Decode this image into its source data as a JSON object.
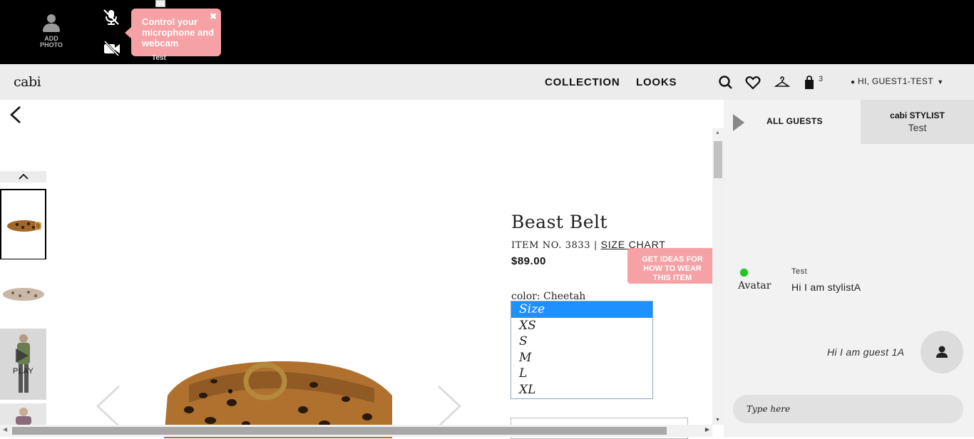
{
  "topbar": {
    "add_photo_label": "ADD PHOTO",
    "tooltip_text": "Control your microphone and webcam",
    "tooltip_close": "✖",
    "peek_name": "Test"
  },
  "nav": {
    "logo": "cabi",
    "links": [
      "COLLECTION",
      "LOOKS"
    ],
    "bag_count": "3",
    "user_greeting": "HI, GUEST1-TEST",
    "user_caret": "▼"
  },
  "product": {
    "thumb_play_label": "PLAY",
    "name": "Beast Belt",
    "item_no": "ITEM NO. 3833 | ",
    "size_chart_label": "SIZE CHART",
    "price": "$89.00",
    "ideas_label": "GET IDEAS FOR HOW TO WEAR THIS ITEM",
    "color_label": "color: Cheetah",
    "size_options": [
      "Size",
      "XS",
      "S",
      "M",
      "L",
      "XL"
    ],
    "size_selected": "Size"
  },
  "chat": {
    "tab_all_guests": "ALL GUESTS",
    "tab_stylist_title": "cabi STYLIST",
    "tab_stylist_name": "Test",
    "messages": [
      {
        "sender": "Test",
        "avatar_alt": "Avatar",
        "text": "Hi I am stylistA"
      },
      {
        "sender": "guest",
        "text": "Hi I am guest 1A"
      }
    ],
    "input_placeholder": "Type here"
  },
  "colors": {
    "accent_pink": "#f5a1a5",
    "select_blue": "#1e90ff",
    "online_green": "#1ec61e",
    "topbar_bg": "#000000",
    "navbar_bg": "#ececec"
  }
}
